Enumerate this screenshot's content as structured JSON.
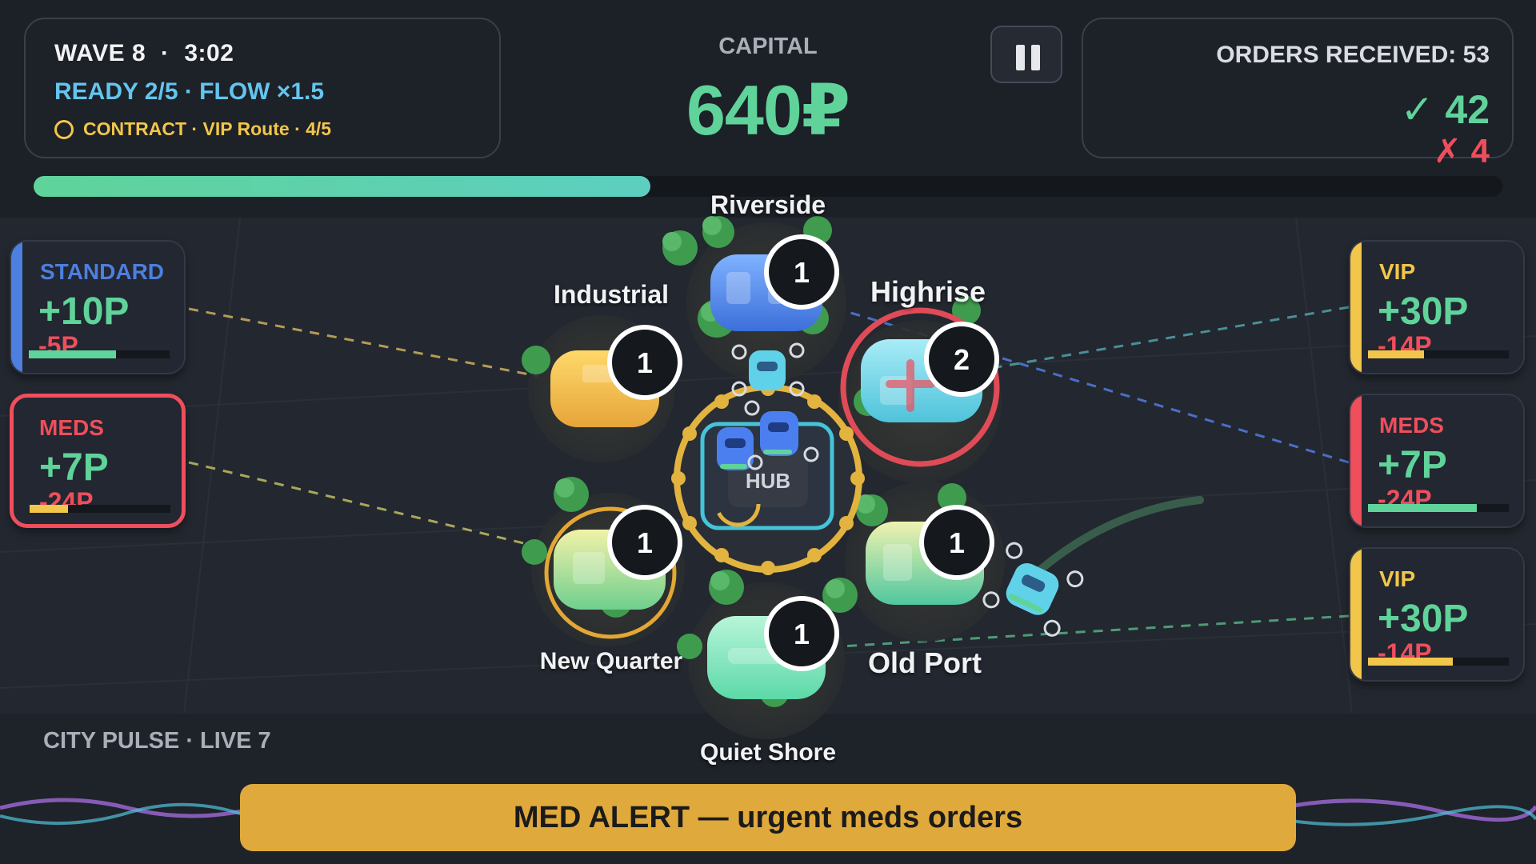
{
  "hud": {
    "wave": "WAVE 8",
    "sep": "·",
    "timer": "3:02",
    "ready": "READY 2/5 · FLOW ×1.5",
    "contract": "CONTRACT · VIP Route · 4/5",
    "capital_label": "CAPITAL",
    "capital_value": "640₽",
    "orders_received": "ORDERS RECEIVED: 53",
    "success": "✓ 42",
    "failed": "✗ 4",
    "wave_progress": 0.42
  },
  "left_orders": [
    {
      "type": "STANDARD",
      "reward": "+10P",
      "penalty": "-5P",
      "progress": 0.62,
      "accent": "#4d7fe0"
    },
    {
      "type": "MEDS",
      "reward": "+7P",
      "penalty": "-24P",
      "progress": 0.27,
      "accent": "#ef4e5c"
    }
  ],
  "right_orders": [
    {
      "type": "VIP",
      "reward": "+30P",
      "penalty": "-14P",
      "progress": 0.4,
      "accent": "#f2c64a"
    },
    {
      "type": "MEDS",
      "reward": "+7P",
      "penalty": "-24P",
      "progress": 0.77,
      "accent": "#ef4e5c"
    },
    {
      "type": "VIP",
      "reward": "+30P",
      "penalty": "-14P",
      "progress": 0.6,
      "accent": "#f2c64a"
    }
  ],
  "districts": {
    "riverside": {
      "name": "Riverside",
      "orders": "1"
    },
    "industrial": {
      "name": "Industrial",
      "orders": "1"
    },
    "highrise": {
      "name": "Highrise",
      "orders": "2"
    },
    "new_quarter": {
      "name": "New Quarter",
      "orders": "1"
    },
    "old_port": {
      "name": "Old Port",
      "orders": "1"
    },
    "quiet_shore": {
      "name": "Quiet Shore",
      "orders": "1"
    }
  },
  "hub": {
    "label": "HUB"
  },
  "footer": {
    "pulse": "CITY PULSE · LIVE 7",
    "alert": "MED ALERT — urgent meds orders"
  },
  "colors": {
    "accent_green": "#5fd39a",
    "alert_red": "#ef4e5c",
    "vip_gold": "#f2c64a",
    "standard_blue": "#4d7fe0",
    "banner": "#dfa93b"
  }
}
